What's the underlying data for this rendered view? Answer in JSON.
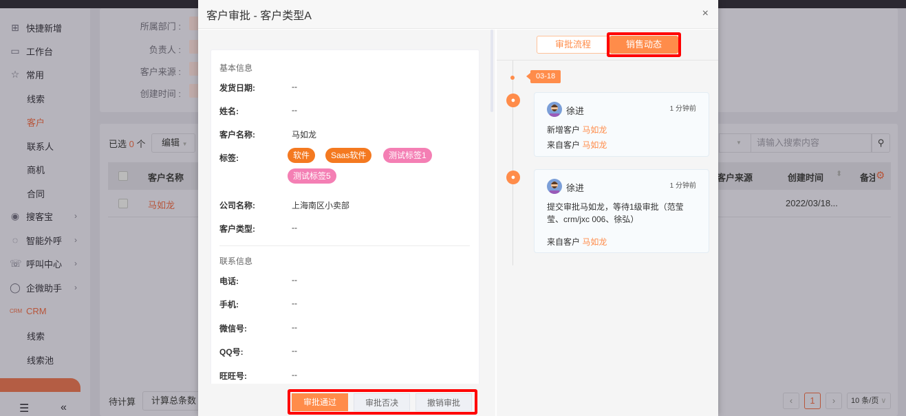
{
  "sidebar": {
    "items": [
      {
        "label": "快捷新增",
        "icon": "plus-square-icon"
      },
      {
        "label": "工作台",
        "icon": "monitor-icon"
      },
      {
        "label": "常用",
        "icon": "star-icon"
      }
    ],
    "common_sub": [
      "线索",
      "客户",
      "联系人",
      "商机",
      "合同"
    ],
    "groups": [
      {
        "label": "搜客宝",
        "icon": "search-radar-icon"
      },
      {
        "label": "智能外呼",
        "icon": "phone-bubble-icon"
      },
      {
        "label": "呼叫中心",
        "icon": "call-icon"
      },
      {
        "label": "企微助手",
        "icon": "wecom-icon"
      }
    ],
    "crm": {
      "label": "CRM",
      "icon": "crm-icon"
    },
    "crm_sub": [
      "线索",
      "线索池"
    ],
    "active_color": "#e66a44"
  },
  "filters": [
    "所属部门 :",
    "负责人 :",
    "客户来源 :",
    "创建时间 :"
  ],
  "table": {
    "selected_prefix": "已选",
    "selected_count": "0",
    "selected_suffix": "个",
    "edit_label": "编辑",
    "search_placeholder": "请输入搜索内容",
    "headers": [
      "客户名称",
      "客户来源",
      "创建时间",
      "备注"
    ],
    "rows": [
      {
        "name": "马如龙",
        "created": "2022/03/18..."
      }
    ],
    "pending": "待计算",
    "count_button": "计算总条数",
    "page": "1",
    "page_size": "10 条/页"
  },
  "modal": {
    "title": "客户审批 - 客户类型A",
    "close": "×",
    "basic_title": "基本信息",
    "basic": [
      {
        "k": "发货日期:",
        "v": "--"
      },
      {
        "k": "姓名:",
        "v": "--"
      },
      {
        "k": "客户名称:",
        "v": "马如龙"
      },
      {
        "k": "标签:",
        "v": ""
      },
      {
        "k": "公司名称:",
        "v": "上海南区小卖部"
      },
      {
        "k": "客户类型:",
        "v": "--"
      }
    ],
    "tags": [
      {
        "label": "软件",
        "color": "#f47920"
      },
      {
        "label": "Saas软件",
        "color": "#f47920"
      },
      {
        "label": "测试标签1",
        "color": "#f47fb4"
      },
      {
        "label": "测试标签5",
        "color": "#f47fb4"
      }
    ],
    "contact_title": "联系信息",
    "contact": [
      {
        "k": "电话:",
        "v": "--"
      },
      {
        "k": "手机:",
        "v": "--"
      },
      {
        "k": "微信号:",
        "v": "--"
      },
      {
        "k": "QQ号:",
        "v": "--"
      },
      {
        "k": "旺旺号:",
        "v": "--"
      }
    ],
    "buttons": {
      "approve": "审批通过",
      "reject": "审批否决",
      "revoke": "撤销审批"
    },
    "tabs": {
      "flow": "审批流程",
      "sales": "销售动态",
      "active": "sales"
    },
    "timeline": {
      "date": "03-18",
      "entries": [
        {
          "user": "徐进",
          "time": "1 分钟前",
          "lines": [
            {
              "text": "新增客户 ",
              "link": "马如龙"
            },
            {
              "text": "来自客户 ",
              "link": "马如龙"
            }
          ]
        },
        {
          "user": "徐进",
          "time": "1 分钟前",
          "body1": "提交审批马如龙，等待1级审批（范莹",
          "body2": "莹、crm/jxc 006、徐弘）",
          "from": "来自客户 ",
          "link": "马如龙"
        }
      ]
    },
    "accent": "#ff8c4a"
  }
}
